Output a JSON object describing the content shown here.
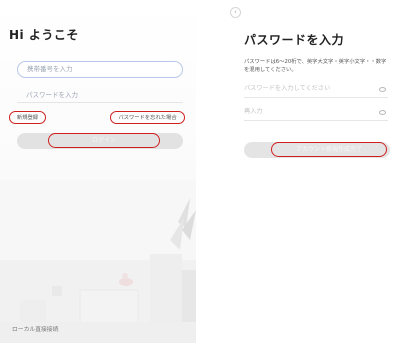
{
  "login": {
    "title": "Hi ようこそ",
    "phone_placeholder": "携帯番号を入力",
    "password_placeholder": "パスワードを入力",
    "register_link": "新規登録",
    "forgot_link": "パスワードを忘れた場合",
    "login_button": "ログイン",
    "local_connect": "ローカル直接接続"
  },
  "set_password": {
    "back_icon": "chevron-left-icon",
    "title": "パスワードを入力",
    "hint": "パスワードは6〜20桁で、英字大文字・英字小文字・・数字を混用してください。",
    "password_placeholder": "パスワードを入力してください",
    "reenter_placeholder": "再入力",
    "eye_icon": "eye-icon",
    "submit_button": "アカウント新規作成完了"
  },
  "colors": {
    "annotation": "#cf1f1f",
    "focus_border": "#b8c8ea",
    "button_bg": "#e2e2e2"
  }
}
